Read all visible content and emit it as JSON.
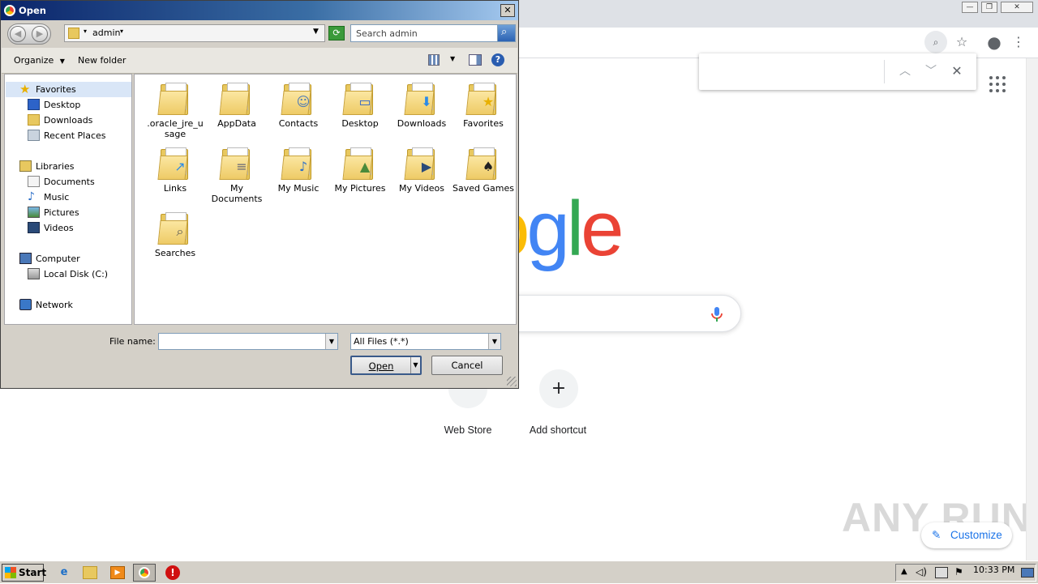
{
  "dialog": {
    "title": "Open",
    "address": "admin",
    "search_placeholder": "Search admin",
    "organize_label": "Organize",
    "new_folder_label": "New folder",
    "nav": {
      "favorites": "Favorites",
      "favorites_items": [
        "Desktop",
        "Downloads",
        "Recent Places"
      ],
      "libraries": "Libraries",
      "libraries_items": [
        "Documents",
        "Music",
        "Pictures",
        "Videos"
      ],
      "computer": "Computer",
      "computer_items": [
        "Local Disk (C:)"
      ],
      "network": "Network"
    },
    "folders": [
      {
        "label": ".oracle_jre_u sage",
        "icon": "folder-blank-icon"
      },
      {
        "label": "AppData",
        "icon": "folder-appdata-icon"
      },
      {
        "label": "Contacts",
        "icon": "folder-contacts-icon"
      },
      {
        "label": "Desktop",
        "icon": "folder-desktop-icon"
      },
      {
        "label": "Downloads",
        "icon": "folder-downloads-icon"
      },
      {
        "label": "Favorites",
        "icon": "folder-favorites-icon"
      },
      {
        "label": "Links",
        "icon": "folder-links-icon"
      },
      {
        "label": "My Documents",
        "icon": "folder-documents-icon"
      },
      {
        "label": "My Music",
        "icon": "folder-music-icon"
      },
      {
        "label": "My Pictures",
        "icon": "folder-pictures-icon"
      },
      {
        "label": "My Videos",
        "icon": "folder-videos-icon"
      },
      {
        "label": "Saved Games",
        "icon": "folder-games-icon"
      },
      {
        "label": "Searches",
        "icon": "folder-searches-icon"
      }
    ],
    "file_name_label": "File name:",
    "file_name_value": "",
    "file_type": "All Files (*.*)",
    "open_label": "Open",
    "cancel_label": "Cancel"
  },
  "browser": {
    "logo_text": "ogle",
    "shortcuts": [
      {
        "label": "Web Store"
      },
      {
        "label": "Add shortcut",
        "glyph": "+"
      }
    ],
    "customize_label": "Customize",
    "watermark": "ANY RUN"
  },
  "taskbar": {
    "start_label": "Start",
    "clock": "10:33 PM"
  },
  "colors": {
    "title_bar": "#0a246a",
    "google_blue": "#4285f4",
    "google_red": "#ea4335",
    "google_yellow": "#fbbc05",
    "google_green": "#34a853",
    "customize_blue": "#1a73e8"
  }
}
